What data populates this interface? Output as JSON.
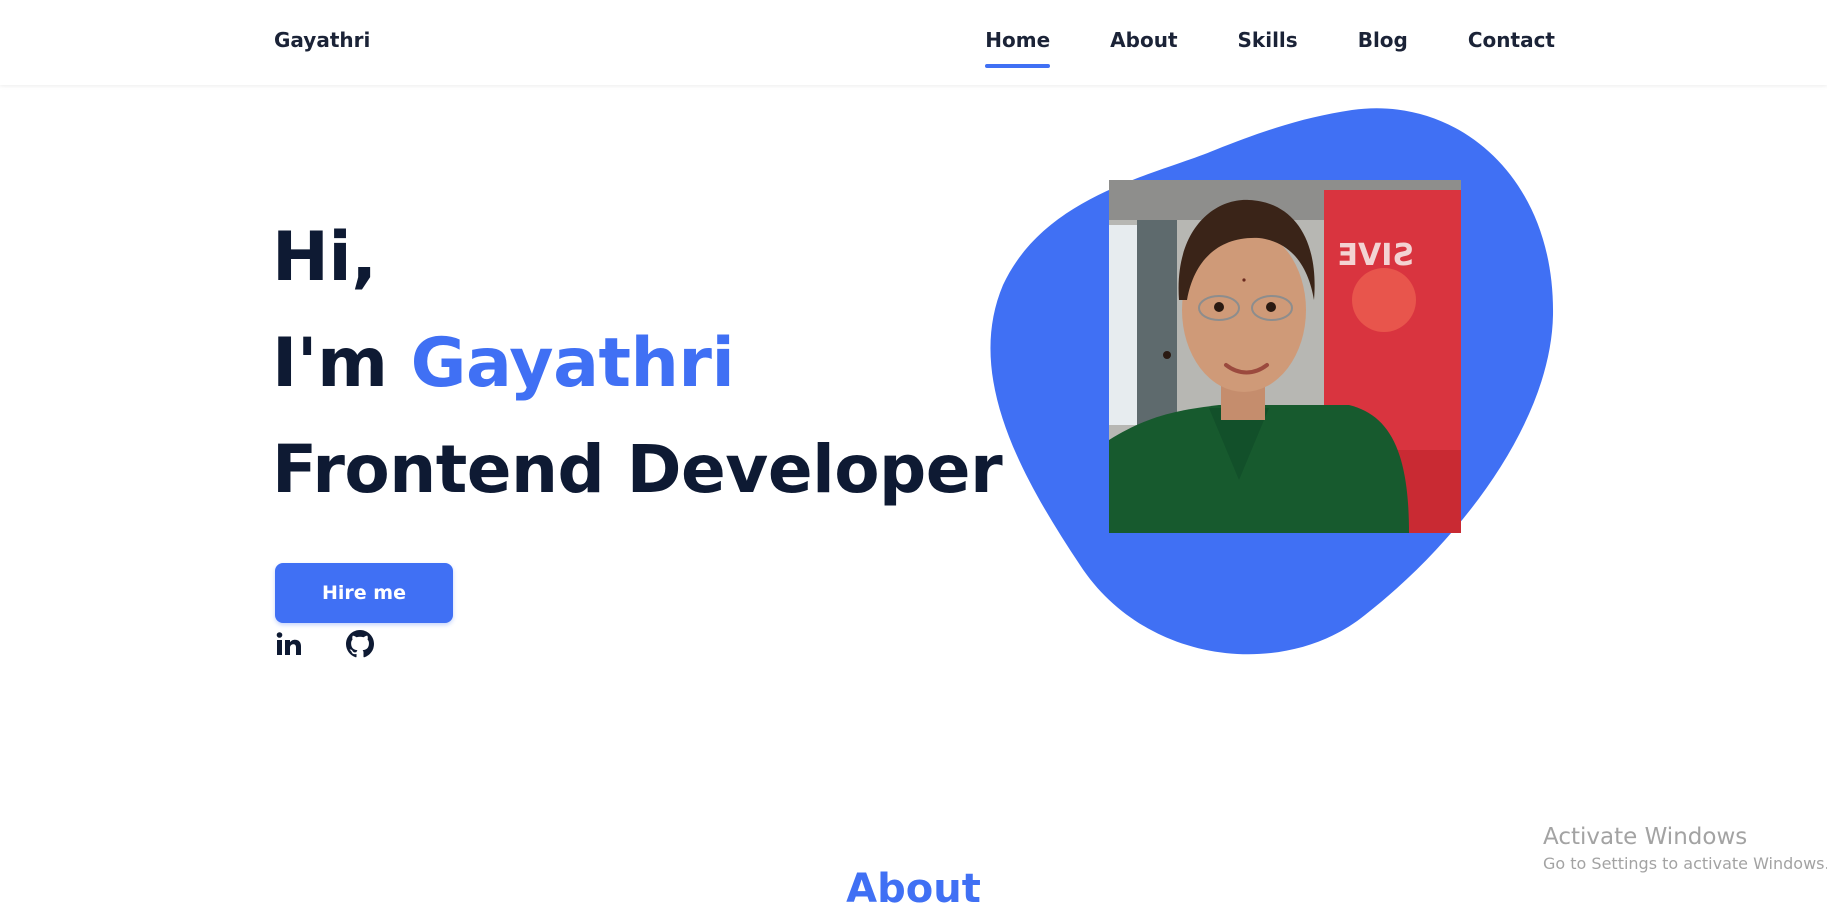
{
  "header": {
    "logo": "Gayathri",
    "nav": [
      {
        "label": "Home",
        "active": true
      },
      {
        "label": "About",
        "active": false
      },
      {
        "label": "Skills",
        "active": false
      },
      {
        "label": "Blog",
        "active": false
      },
      {
        "label": "Contact",
        "active": false
      }
    ]
  },
  "hero": {
    "greeting": "Hi,",
    "intro_prefix": "I'm",
    "name": "Gayathri",
    "role": "Frontend Developer",
    "cta_label": "Hire me",
    "social": [
      {
        "name": "linkedin-icon"
      },
      {
        "name": "github-icon"
      }
    ]
  },
  "about": {
    "title": "About"
  },
  "watermark": {
    "title": "Activate Windows",
    "subtitle": "Go to Settings to activate Windows."
  },
  "colors": {
    "accent": "#4070f4",
    "heading": "#0e1a33",
    "background": "#ffffff"
  }
}
